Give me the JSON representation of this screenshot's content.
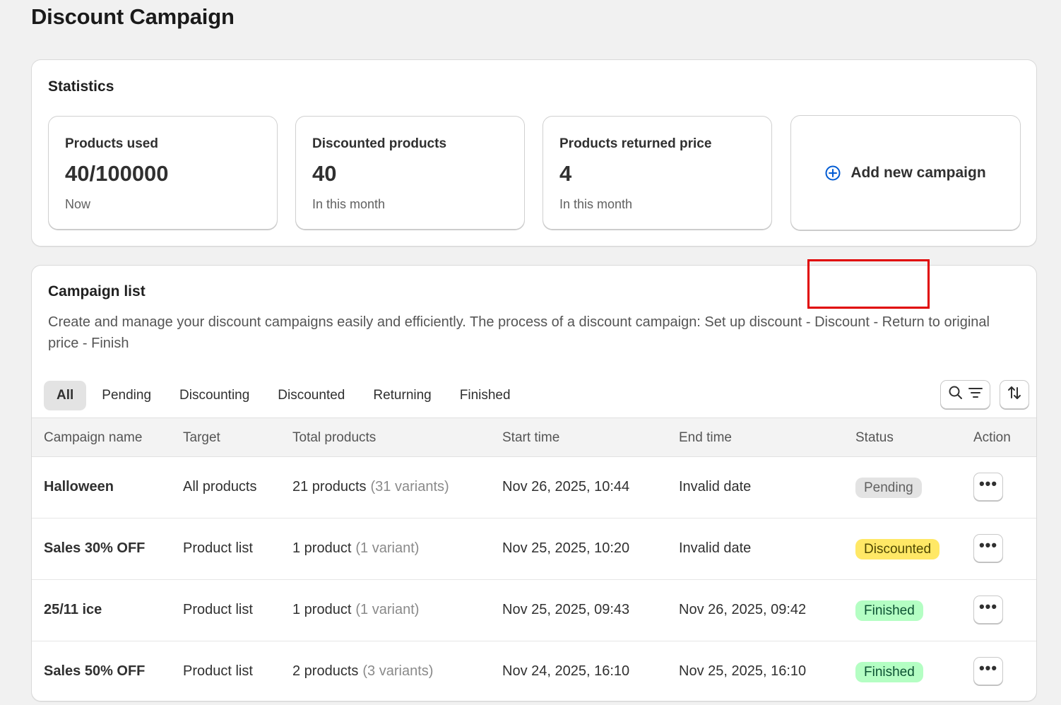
{
  "page": {
    "title": "Discount Campaign"
  },
  "statistics": {
    "title": "Statistics",
    "cards": [
      {
        "label": "Products used",
        "value": "40/100000",
        "sub": "Now"
      },
      {
        "label": "Discounted products",
        "value": "40",
        "sub": "In this month"
      },
      {
        "label": "Products returned price",
        "value": "4",
        "sub": "In this month"
      }
    ],
    "add_campaign_label": "Add new campaign"
  },
  "campaign_list": {
    "title": "Campaign list",
    "description": "Create and manage your discount campaigns easily and efficiently. The process of a discount campaign: Set up discount - Discount - Return to original price - Finish",
    "tabs": [
      "All",
      "Pending",
      "Discounting",
      "Discounted",
      "Returning",
      "Finished"
    ],
    "active_tab": "All",
    "columns": [
      "Campaign name",
      "Target",
      "Total products",
      "Start time",
      "End time",
      "Status",
      "Action"
    ],
    "rows": [
      {
        "name": "Halloween",
        "target": "All products",
        "products": "21 products",
        "variants": "(31 variants)",
        "start": "Nov 26, 2025, 10:44",
        "end": "Invalid date",
        "status": "Pending"
      },
      {
        "name": "Sales 30% OFF",
        "target": "Product list",
        "products": "1 product",
        "variants": "(1 variant)",
        "start": "Nov 25, 2025, 10:20",
        "end": "Invalid date",
        "status": "Discounted"
      },
      {
        "name": "25/11 ice",
        "target": "Product list",
        "products": "1 product",
        "variants": "(1 variant)",
        "start": "Nov 25, 2025, 09:43",
        "end": "Nov 26, 2025, 09:42",
        "status": "Finished"
      },
      {
        "name": "Sales 50% OFF",
        "target": "Product list",
        "products": "2 products",
        "variants": "(3 variants)",
        "start": "Nov 24, 2025, 16:10",
        "end": "Nov 25, 2025, 16:10",
        "status": "Finished"
      }
    ],
    "action_label": "•••"
  },
  "status_colors": {
    "Pending": {
      "bg": "#e3e3e3",
      "fg": "#616161"
    },
    "Discounted": {
      "bg": "#ffe866",
      "fg": "#4f4700"
    },
    "Finished": {
      "bg": "#b4fec3",
      "fg": "#0c5132"
    }
  },
  "icons": {
    "add": "plus-circle-icon",
    "search": "search-icon",
    "filter": "filter-icon",
    "sort": "sort-icon",
    "action": "more-horizontal-icon"
  },
  "colors": {
    "accent": "#005bd3",
    "highlight": "#e00000"
  }
}
